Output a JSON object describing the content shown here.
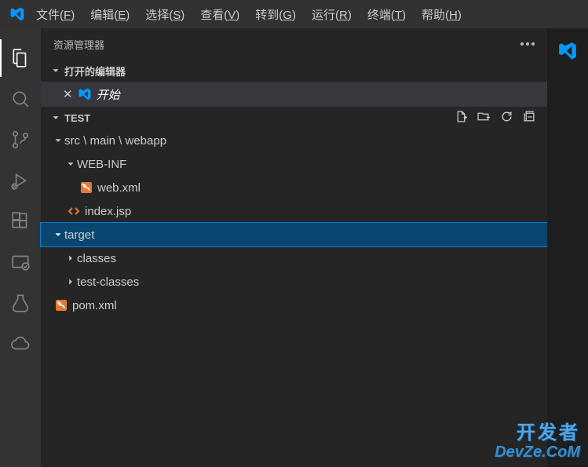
{
  "menubar": {
    "items": [
      {
        "label": "文件",
        "key": "F"
      },
      {
        "label": "编辑",
        "key": "E"
      },
      {
        "label": "选择",
        "key": "S"
      },
      {
        "label": "查看",
        "key": "V"
      },
      {
        "label": "转到",
        "key": "G"
      },
      {
        "label": "运行",
        "key": "R"
      },
      {
        "label": "终端",
        "key": "T"
      },
      {
        "label": "帮助",
        "key": "H"
      }
    ]
  },
  "sidebar": {
    "title": "资源管理器",
    "sections": {
      "openEditors": {
        "label": "打开的编辑器",
        "items": [
          {
            "label": "开始"
          }
        ]
      },
      "project": {
        "label": "TEST"
      }
    }
  },
  "tree": {
    "items": [
      {
        "label": "src \\ main \\ webapp",
        "type": "folder",
        "expanded": true,
        "depth": 1
      },
      {
        "label": "WEB-INF",
        "type": "folder",
        "expanded": true,
        "depth": 2
      },
      {
        "label": "web.xml",
        "type": "file",
        "icon": "rss",
        "color": "#e37933",
        "depth": 3
      },
      {
        "label": "index.jsp",
        "type": "file",
        "icon": "code",
        "color": "#e37933",
        "depth": 2
      },
      {
        "label": "target",
        "type": "folder",
        "expanded": true,
        "depth": 1,
        "selected": true
      },
      {
        "label": "classes",
        "type": "folder",
        "expanded": false,
        "depth": 2
      },
      {
        "label": "test-classes",
        "type": "folder",
        "expanded": false,
        "depth": 2
      },
      {
        "label": "pom.xml",
        "type": "file",
        "icon": "rss",
        "color": "#e37933",
        "depth": 1
      }
    ]
  },
  "watermark": {
    "line1": "开发者",
    "line2": "DevZe.CoM"
  }
}
